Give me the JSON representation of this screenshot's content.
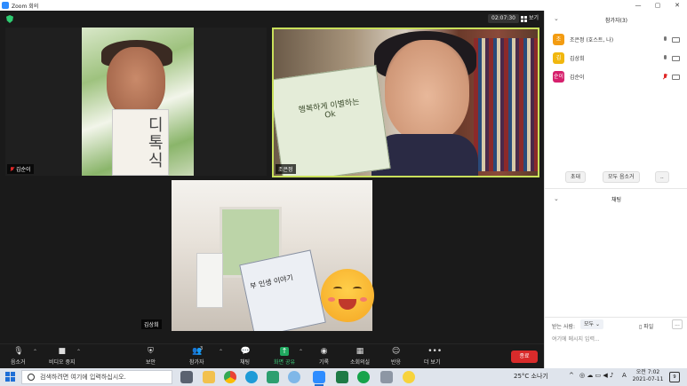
{
  "window": {
    "title": "Zoom 회의"
  },
  "meeting": {
    "timer": "02:07:30",
    "view_label": "보기"
  },
  "tiles": [
    {
      "name": "김순이",
      "muted": true,
      "book_text": "디 톡\n식 원"
    },
    {
      "name": "조은정",
      "muted": false,
      "book_text": "사는 동안 행복하게 이별하는 Ok"
    },
    {
      "name": "김상희",
      "muted": false,
      "book_text": "숲에서 읽는 부 인생 이야기"
    }
  ],
  "toolbar": {
    "mute": "음소거",
    "video": "비디오 중지",
    "security": "보안",
    "participants": "참가자",
    "participants_count": "3",
    "chat": "채팅",
    "share": "화면 공유",
    "record": "기록",
    "breakout": "소회의실",
    "reactions": "반응",
    "more": "더 보기",
    "end": "종료"
  },
  "panel": {
    "participants_title": "참가자(3)",
    "participants": [
      {
        "initial": "조",
        "name": "조은정 (호스트, 나)",
        "color": "#f39c12",
        "mic_muted": false
      },
      {
        "initial": "김",
        "name": "김상희",
        "color": "#f1b70e",
        "mic_muted": false
      },
      {
        "initial": "순이",
        "name": "김순이",
        "color": "#d6206d",
        "mic_muted": true
      }
    ],
    "invite_label": "초대",
    "mute_all_label": "모두 음소거",
    "more_label": "..",
    "chat_title": "채팅",
    "to_label": "받는 사람:",
    "to_value": "모두 ⌄",
    "file_label": "파일",
    "more2_label": "...",
    "input_placeholder": "여기에 메시지 입력..."
  },
  "taskbar": {
    "search_placeholder": "검색하려면 여기에 입력하십시오.",
    "weather": "25°C 소나기",
    "lang": "A",
    "time": "오전 7:02",
    "date": "2021-07-11",
    "notif_count": "9"
  }
}
